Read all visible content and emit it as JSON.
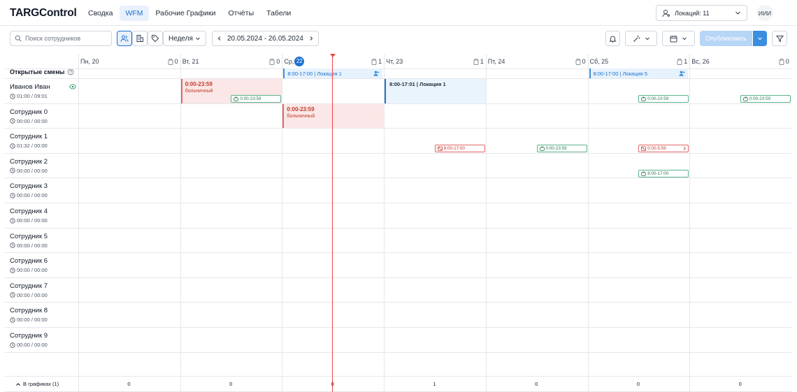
{
  "app": {
    "logo": "TARGControl"
  },
  "nav": [
    "Сводка",
    "WFM",
    "Рабочие Графики",
    "Отчёты",
    "Табели"
  ],
  "nav_active": 1,
  "location_select": {
    "label": "Локаций: 11"
  },
  "user": {
    "initials": "ИИИ"
  },
  "toolbar": {
    "search_placeholder": "Поиск сотрудников",
    "period": "Неделя",
    "date_range": "20.05.2024 - 26.05.2024",
    "publish": "Опубликовать"
  },
  "days": [
    {
      "label": "Пн, 20",
      "count": "0"
    },
    {
      "label": "Вт, 21",
      "count": "0"
    },
    {
      "label": "Ср,",
      "badge": "22",
      "count": "1"
    },
    {
      "label": "Чт, 23",
      "count": "1"
    },
    {
      "label": "Пт, 24",
      "count": "0"
    },
    {
      "label": "Сб, 25",
      "count": "1"
    },
    {
      "label": "Вс, 26",
      "count": "0"
    }
  ],
  "open_shifts_label": "Открытые смены",
  "open_shifts": [
    {
      "day": 2,
      "text": "8:00-17:00 | Локация 1"
    },
    {
      "day": 5,
      "text": "8:00-17:00 | Локация 5"
    }
  ],
  "employees": [
    {
      "name": "Иванов Иван",
      "hours": "01:00 / 09:01"
    },
    {
      "name": "Сотрудник 0",
      "hours": "00:00 / 00:00"
    },
    {
      "name": "Сотрудник 1",
      "hours": "01:32 / 00:00"
    },
    {
      "name": "Сотрудник 2",
      "hours": "00:00 / 00:00"
    },
    {
      "name": "Сотрудник 3",
      "hours": "00:00 / 00:00"
    },
    {
      "name": "Сотрудник 4",
      "hours": "00:00 / 00:00"
    },
    {
      "name": "Сотрудник 5",
      "hours": "00:00 / 00:00"
    },
    {
      "name": "Сотрудник 6",
      "hours": "00:00 / 00:00"
    },
    {
      "name": "Сотрудник 7",
      "hours": "00:00 / 00:00"
    },
    {
      "name": "Сотрудник 8",
      "hours": "00:00 / 00:00"
    },
    {
      "name": "Сотрудник 9",
      "hours": "00:00 / 00:00"
    }
  ],
  "absences": [
    {
      "row": 0,
      "day": 1,
      "time": "0:00-23:59",
      "label": "больничный"
    },
    {
      "row": 1,
      "day": 2,
      "time": "0:00-23:59",
      "label": "больничный"
    }
  ],
  "shifts": [
    {
      "row": 0,
      "day": 3,
      "text": "8:00-17:01 | Локация 1"
    }
  ],
  "chips": [
    {
      "row": 0,
      "day": 1,
      "text": "0:00-23:59",
      "color": "green"
    },
    {
      "row": 0,
      "day": 5,
      "text": "0:00-23:59",
      "color": "green"
    },
    {
      "row": 0,
      "day": 6,
      "text": "0:00-23:59",
      "color": "green"
    },
    {
      "row": 2,
      "day": 3,
      "text": "8:00-17:00",
      "color": "red"
    },
    {
      "row": 2,
      "day": 4,
      "text": "0:00-23:59",
      "color": "green"
    },
    {
      "row": 2,
      "day": 5,
      "text": "0:00-5:59",
      "color": "red"
    },
    {
      "row": 3,
      "day": 5,
      "text": "8:00-17:00",
      "color": "green"
    }
  ],
  "footer": {
    "label": "В графиках (1)",
    "totals": [
      "0",
      "0",
      "0",
      "1",
      "0",
      "0",
      "0"
    ]
  },
  "colors": {
    "accent": "#1d6fd1",
    "now_line": "#ef4444",
    "absence_bg": "#fbe7e7",
    "chip_green": "#5bb38a"
  }
}
